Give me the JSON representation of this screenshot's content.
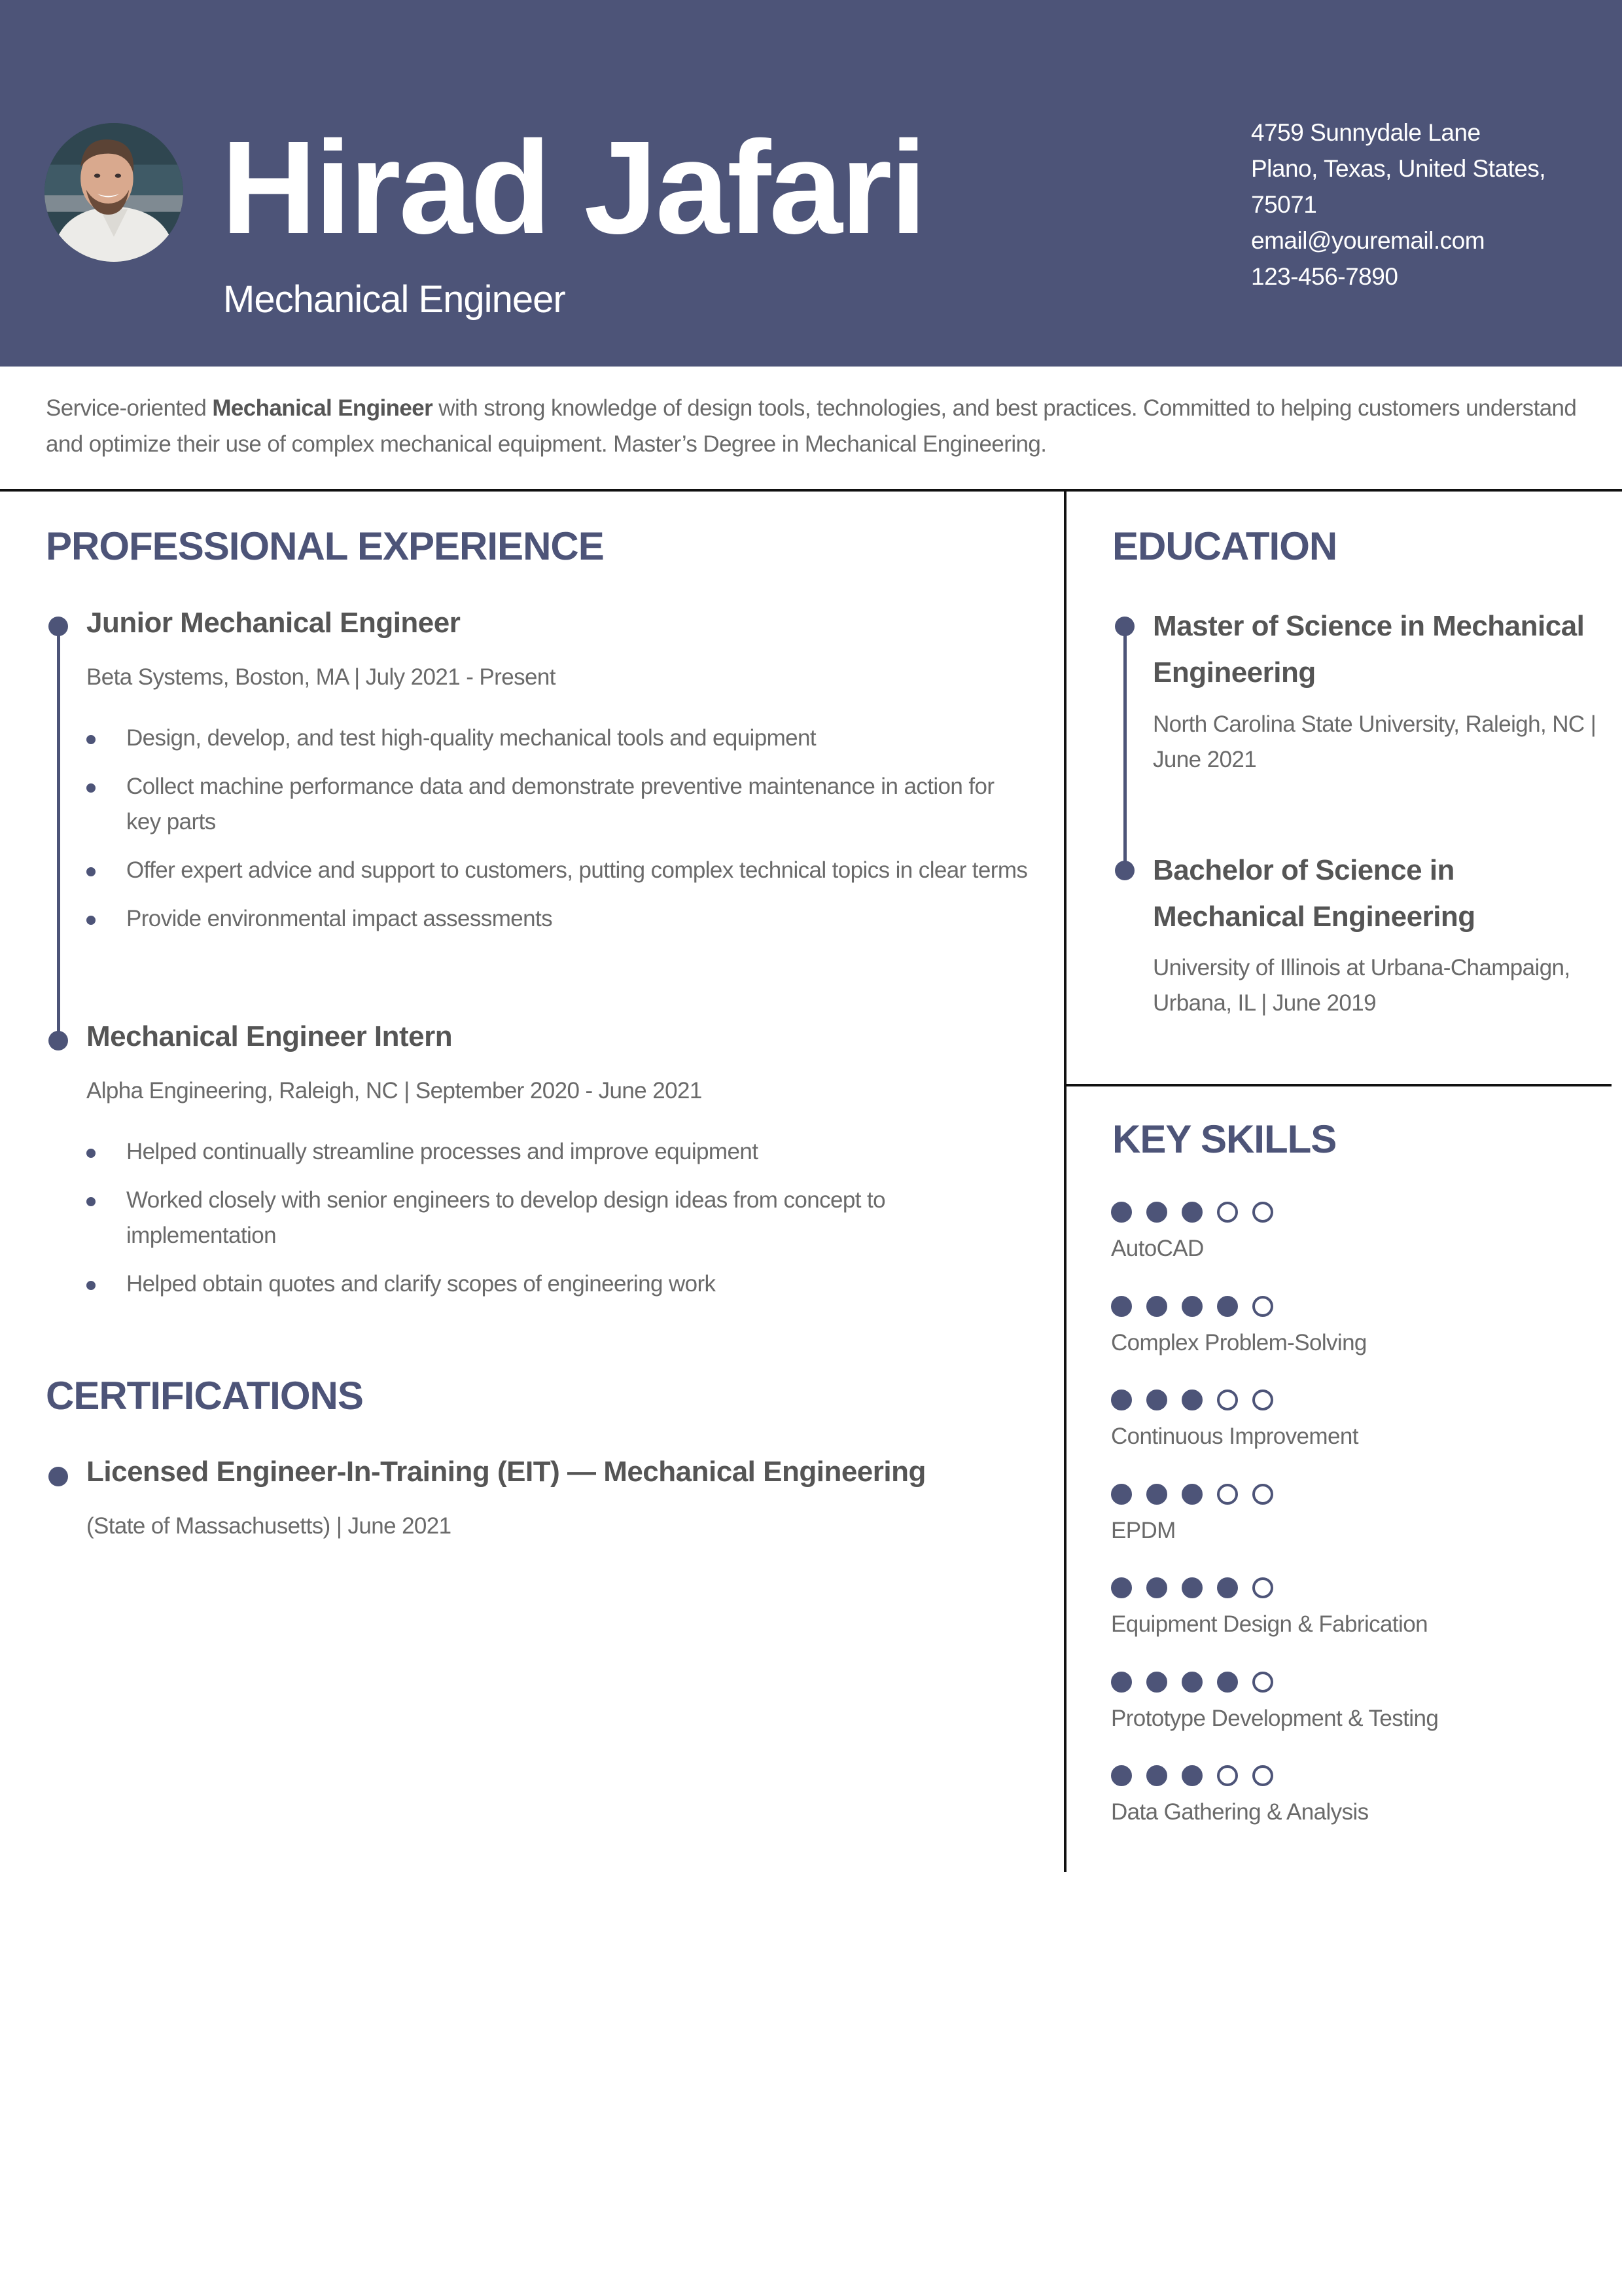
{
  "theme": {
    "accent": "#4d5478",
    "text": "#5a5a5a",
    "divider": "#111111"
  },
  "header": {
    "name": "Hirad Jafari",
    "title": "Mechanical Engineer",
    "avatar_alt": "profile-photo",
    "contact": {
      "address_line1": "4759 Sunnydale Lane",
      "address_line2": "Plano, Texas, United States,",
      "address_line3": "75071",
      "email": "email@youremail.com",
      "phone": "123-456-7890"
    }
  },
  "summary": {
    "before": "Service-oriented ",
    "bold": "Mechanical Engineer",
    "after": " with strong  knowledge of design tools, technologies, and best practices. Committed  to helping customers understand and optimize their use of complex  mechanical equipment. Master’s Degree in Mechanical Engineering."
  },
  "experience": {
    "heading": "PROFESSIONAL EXPERIENCE",
    "jobs": [
      {
        "title": "Junior Mechanical Engineer",
        "meta": "Beta Systems, Boston, MA | July 2021 - Present",
        "bullets": [
          "Design, develop, and test high-quality mechanical tools and equipment",
          "Collect machine performance data and demonstrate preventive maintenance in action for key parts",
          "Offer expert advice and support to customers, putting complex technical topics in clear terms",
          "Provide environmental impact assessments"
        ]
      },
      {
        "title": "Mechanical Engineer Intern",
        "meta": "Alpha Engineering, Raleigh, NC | September 2020 - June 2021",
        "bullets": [
          "Helped continually streamline processes and improve equipment",
          "Worked closely with senior engineers to develop design ideas from concept to implementation",
          "Helped obtain quotes and clarify scopes of engineering work"
        ]
      }
    ]
  },
  "certifications": {
    "heading": "CERTIFICATIONS",
    "items": [
      {
        "title": "Licensed Engineer-In-Training (EIT) — Mechanical Engineering",
        "meta": "(State of Massachusetts) | June 2021"
      }
    ]
  },
  "education": {
    "heading": "EDUCATION",
    "items": [
      {
        "degree": "Master of Science in Mechanical Engineering",
        "meta": "North Carolina State University, Raleigh, NC | June 2021"
      },
      {
        "degree": "Bachelor of Science in Mechanical Engineering",
        "meta": "University of Illinois at Urbana-Champaign, Urbana, IL | June 2019"
      }
    ]
  },
  "skills": {
    "heading": "KEY SKILLS",
    "max_rating": 5,
    "items": [
      {
        "name": "AutoCAD",
        "rating": 3
      },
      {
        "name": "Complex Problem-Solving",
        "rating": 4
      },
      {
        "name": "Continuous Improvement",
        "rating": 3
      },
      {
        "name": "EPDM",
        "rating": 3
      },
      {
        "name": "Equipment Design & Fabrication",
        "rating": 4
      },
      {
        "name": "Prototype Development & Testing",
        "rating": 4
      },
      {
        "name": "Data Gathering & Analysis",
        "rating": 3
      }
    ]
  }
}
